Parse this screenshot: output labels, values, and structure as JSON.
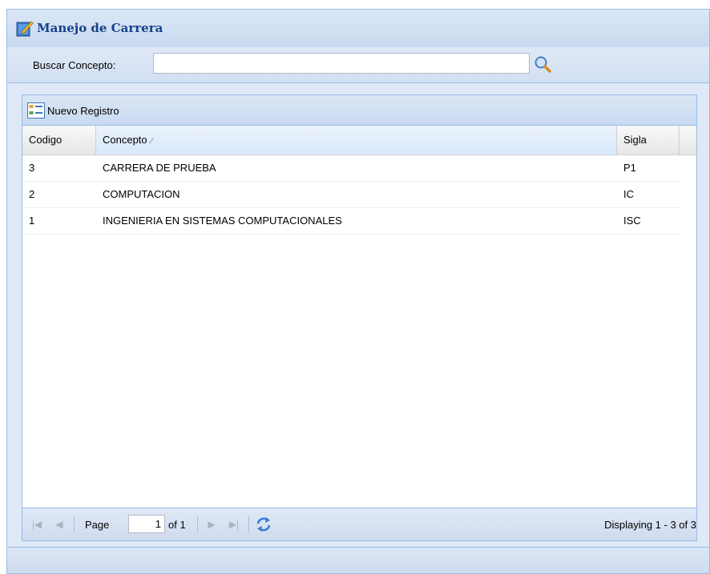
{
  "panel": {
    "title": "Manejo de Carrera",
    "title_icon": "edit-icon"
  },
  "search": {
    "label": "Buscar Concepto:",
    "value": "",
    "placeholder": "",
    "icon": "search-icon"
  },
  "grid": {
    "toolbar": {
      "new_label": "Nuevo Registro",
      "new_icon": "form-icon"
    },
    "columns": [
      {
        "label": "Codigo"
      },
      {
        "label": "Concepto",
        "sorted": true
      },
      {
        "label": "Sigla"
      }
    ],
    "rows": [
      {
        "codigo": "3",
        "concepto": "CARRERA DE PRUEBA",
        "sigla": "P1"
      },
      {
        "codigo": "2",
        "concepto": "COMPUTACION",
        "sigla": "IC"
      },
      {
        "codigo": "1",
        "concepto": "INGENIERIA EN SISTEMAS COMPUTACIONALES",
        "sigla": "ISC"
      }
    ]
  },
  "pager": {
    "page_label": "Page",
    "page_value": "1",
    "of_label": "of 1",
    "displaying": "Displaying 1 - 3 of 3"
  }
}
